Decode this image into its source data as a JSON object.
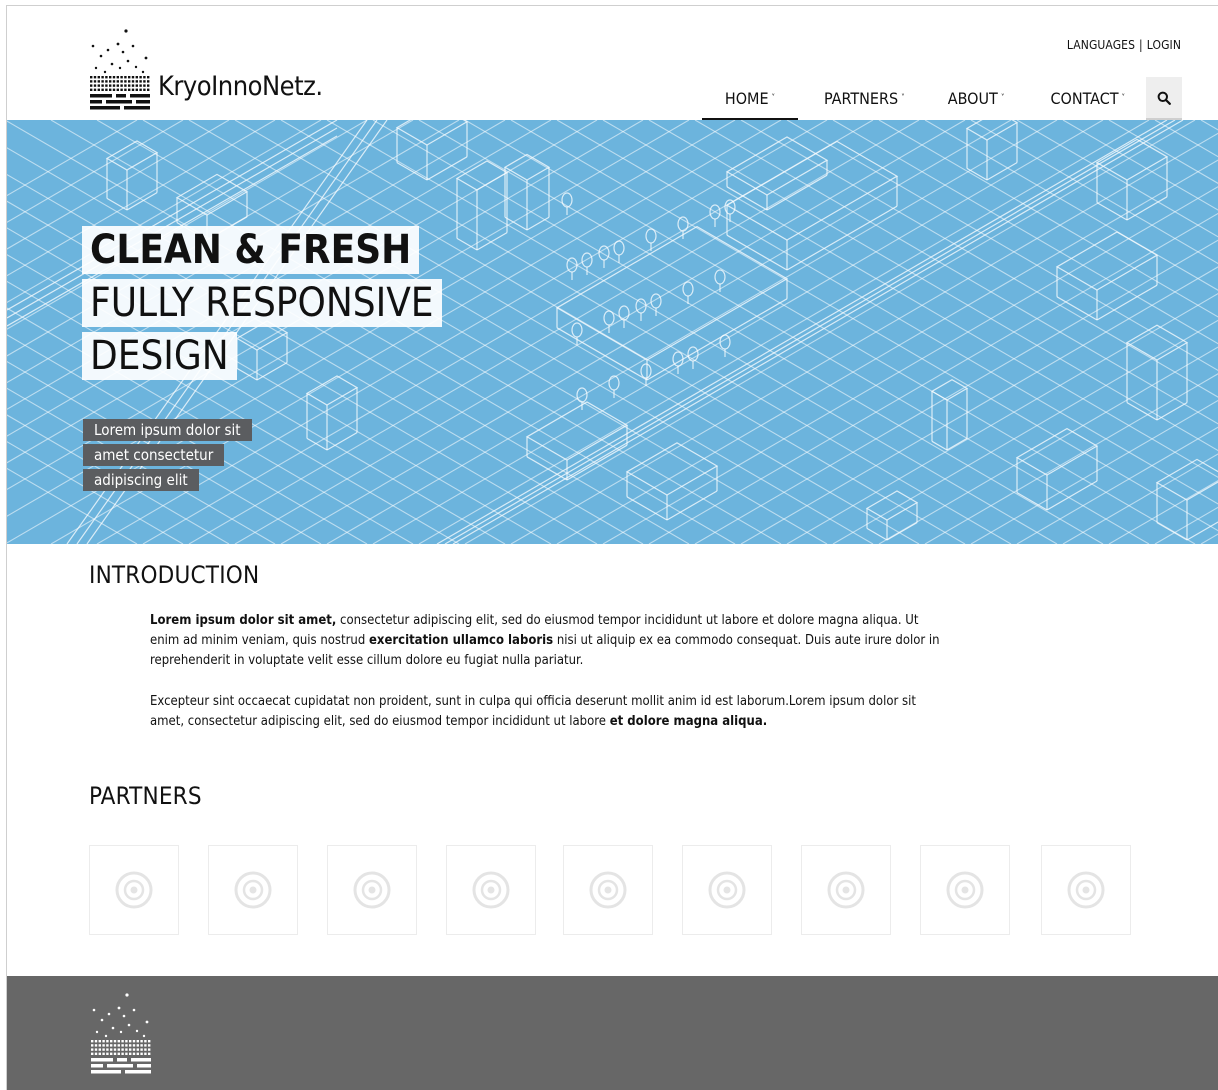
{
  "brand": {
    "name": "KryoInnoNetz."
  },
  "top_links": {
    "languages": "LANGUAGES",
    "separator": "|",
    "login": "LOGIN"
  },
  "nav": {
    "items": [
      {
        "label": "HOME",
        "active": true
      },
      {
        "label": "PARTNERS",
        "active": false
      },
      {
        "label": "ABOUT",
        "active": false
      },
      {
        "label": "CONTACT",
        "active": false
      }
    ],
    "chevron": "˅",
    "search_icon": "search-icon"
  },
  "hero": {
    "line1": "CLEAN & FRESH",
    "line2": "FULLY RESPONSIVE",
    "line3": "DESIGN",
    "sub1": "Lorem ipsum dolor sit",
    "sub2": "amet consectetur",
    "sub3": "adipiscing elit",
    "background_color": "#6cb4dd"
  },
  "intro": {
    "heading": "INTRODUCTION",
    "p1_bold1": "Lorem ipsum dolor sit amet,",
    "p1_text1": " consectetur adipiscing elit, sed do eiusmod tempor incididunt ut labore et dolore magna aliqua. Ut enim ad minim veniam, quis nostrud ",
    "p1_bold2": "exercitation ullamco laboris",
    "p1_text2": " nisi ut aliquip ex ea commodo consequat. Duis aute irure dolor in reprehenderit in voluptate velit esse cillum dolore eu fugiat nulla pariatur.",
    "p2_text": "Excepteur sint occaecat cupidatat non proident, sunt in culpa qui officia deserunt mollit anim id est laborum.Lorem ipsum dolor sit amet, consectetur adipiscing elit, sed do eiusmod tempor incididunt ut labore ",
    "p2_bold": "et dolore magna aliqua."
  },
  "partners": {
    "heading": "PARTNERS",
    "logo_count": 9,
    "logo_icon": "target-icon"
  },
  "footer": {
    "background_color": "#676767"
  }
}
